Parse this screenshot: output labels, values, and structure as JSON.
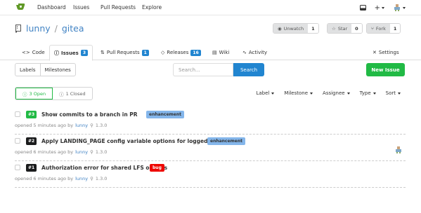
{
  "nav": {
    "links": [
      "Dashboard",
      "Issues",
      "Pull Requests",
      "Explore"
    ],
    "plus": "+"
  },
  "repo": {
    "owner": "lunny",
    "separator": "/",
    "name": "gitea",
    "watch": {
      "label": "Unwatch",
      "count": "1"
    },
    "star": {
      "label": "Star",
      "count": "0"
    },
    "fork": {
      "label": "Fork",
      "count": "1"
    }
  },
  "tabs": {
    "code": "Code",
    "issues": {
      "label": "Issues",
      "count": "3"
    },
    "pulls": {
      "label": "Pull Requests",
      "count": "1"
    },
    "releases": {
      "label": "Releases",
      "count": "16"
    },
    "wiki": "Wiki",
    "activity": "Activity",
    "settings": "Settings"
  },
  "toolbar": {
    "labels": "Labels",
    "milestones": "Milestones",
    "search_placeholder": "Search...",
    "search_button": "Search",
    "new_issue": "New Issue"
  },
  "state": {
    "open": "3 Open",
    "closed": "1 Closed"
  },
  "filters": [
    "Label",
    "Milestone",
    "Assignee",
    "Type",
    "Sort"
  ],
  "issues": [
    {
      "number": "#3",
      "title": "Show commits to a branch in PR",
      "label": "enhancement",
      "label_color": "#84b6eb",
      "label_text": "#333333",
      "num_color": "#21ba45",
      "opened": "opened 5 minutes ago by",
      "user": "lunny",
      "milestone": "1.3.0"
    },
    {
      "number": "#2",
      "title": "Apply LANDING_PAGE config variable options for logged in users",
      "label": "enhancement",
      "label_color": "#84b6eb",
      "label_text": "#333333",
      "num_color": "#1b1c1d",
      "opened": "opened 6 minutes ago by",
      "user": "lunny",
      "milestone": "1.3.0"
    },
    {
      "number": "#1",
      "title": "Authorization error for shared LFS objects",
      "label": "bug",
      "label_color": "#ee0701",
      "label_text": "#ffffff",
      "num_color": "#1b1c1d",
      "opened": "opened 6 minutes ago by",
      "user": "lunny",
      "milestone": "1.3.0"
    }
  ],
  "colors": {
    "primary": "#2185d0",
    "success": "#21ba45",
    "link": "#4183c4"
  }
}
